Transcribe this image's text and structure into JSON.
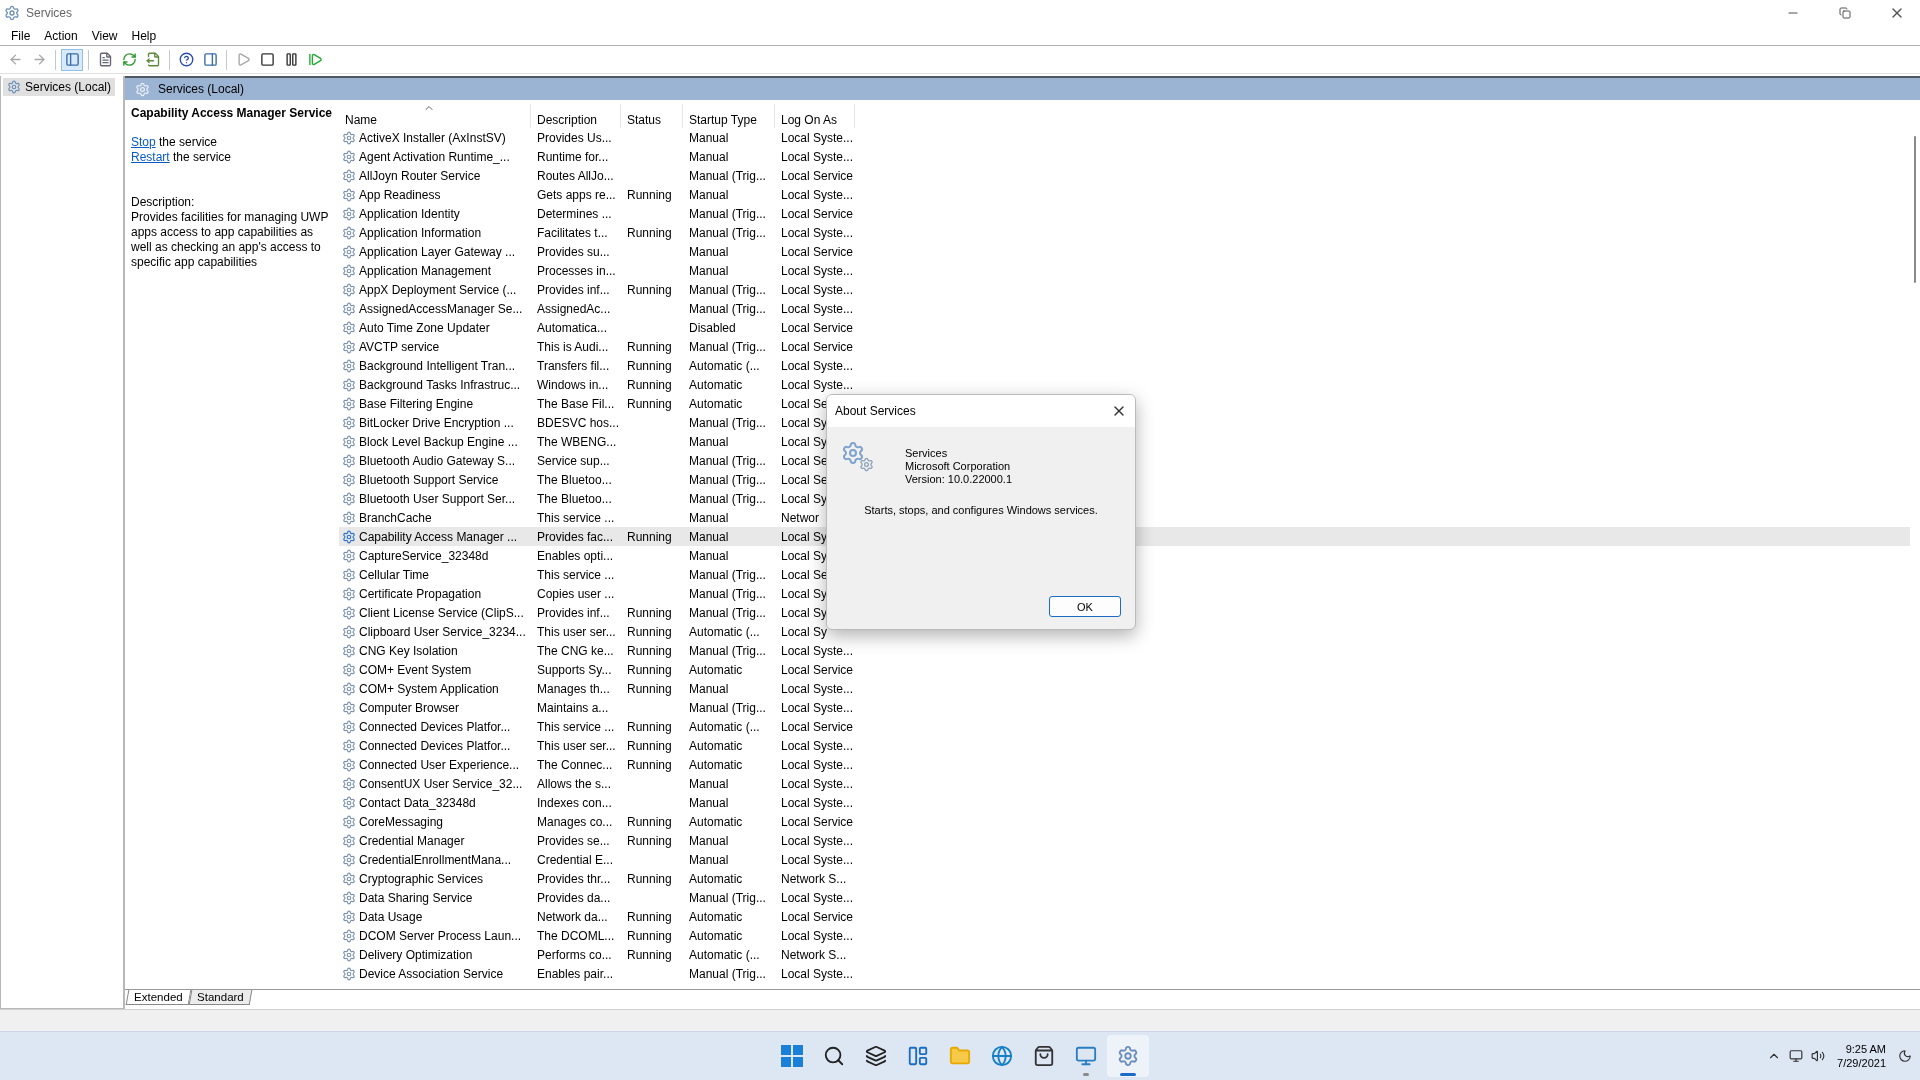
{
  "window": {
    "title": "Services"
  },
  "menu": [
    "File",
    "Action",
    "View",
    "Help"
  ],
  "toolbar": [
    [
      {
        "kind": "back",
        "disabled": true,
        "pressed": false
      },
      {
        "kind": "forward",
        "disabled": true,
        "pressed": false
      }
    ],
    [
      {
        "kind": "tree",
        "disabled": false,
        "pressed": true
      }
    ],
    [
      {
        "kind": "properties",
        "disabled": false,
        "pressed": false
      },
      {
        "kind": "refresh",
        "disabled": false,
        "pressed": false
      },
      {
        "kind": "export",
        "disabled": false,
        "pressed": false
      }
    ],
    [
      {
        "kind": "help",
        "disabled": false,
        "pressed": false
      },
      {
        "kind": "action_pane",
        "disabled": false,
        "pressed": false
      }
    ],
    [
      {
        "kind": "start",
        "disabled": true,
        "pressed": false
      },
      {
        "kind": "stop",
        "disabled": false,
        "pressed": false
      },
      {
        "kind": "pause",
        "disabled": false,
        "pressed": false
      },
      {
        "kind": "resume",
        "disabled": false,
        "pressed": false
      }
    ]
  ],
  "tree": [
    {
      "label": "Services (Local)",
      "selected": true
    }
  ],
  "panel": {
    "title": "Services (Local)"
  },
  "details": {
    "title": "Capability Access Manager Service",
    "actions": [
      {
        "link": "Stop",
        "text": " the service"
      },
      {
        "link": "Restart",
        "text": " the service"
      }
    ],
    "description_label": "Description:",
    "description": "Provides facilities for managing UWP apps access to app capabilities as well as checking an app's access to specific app capabilities"
  },
  "table": {
    "columns": [
      {
        "label": "Name",
        "sorted": true
      },
      {
        "label": "Description",
        "sorted": false
      },
      {
        "label": "Status",
        "sorted": false
      },
      {
        "label": "Startup Type",
        "sorted": false
      },
      {
        "label": "Log On As",
        "sorted": false
      }
    ],
    "rows": [
      {
        "name": "ActiveX Installer (AxInstSV)",
        "description": "Provides Us...",
        "startup_type": "Manual",
        "log_on_as": "Local Syste...",
        "selected": false
      },
      {
        "name": "Agent Activation Runtime_...",
        "description": "Runtime for...",
        "startup_type": "Manual",
        "log_on_as": "Local Syste...",
        "selected": false
      },
      {
        "name": "AllJoyn Router Service",
        "description": "Routes AllJo...",
        "startup_type": "Manual (Trig...",
        "log_on_as": "Local Service",
        "selected": false
      },
      {
        "name": "App Readiness",
        "description": "Gets apps re...",
        "status": "Running",
        "startup_type": "Manual",
        "log_on_as": "Local Syste...",
        "selected": false
      },
      {
        "name": "Application Identity",
        "description": "Determines ...",
        "startup_type": "Manual (Trig...",
        "log_on_as": "Local Service",
        "selected": false
      },
      {
        "name": "Application Information",
        "description": "Facilitates t...",
        "status": "Running",
        "startup_type": "Manual (Trig...",
        "log_on_as": "Local Syste...",
        "selected": false
      },
      {
        "name": "Application Layer Gateway ...",
        "description": "Provides su...",
        "startup_type": "Manual",
        "log_on_as": "Local Service",
        "selected": false
      },
      {
        "name": "Application Management",
        "description": "Processes in...",
        "startup_type": "Manual",
        "log_on_as": "Local Syste...",
        "selected": false
      },
      {
        "name": "AppX Deployment Service (...",
        "description": "Provides inf...",
        "status": "Running",
        "startup_type": "Manual (Trig...",
        "log_on_as": "Local Syste...",
        "selected": false
      },
      {
        "name": "AssignedAccessManager Se...",
        "description": "AssignedAc...",
        "startup_type": "Manual (Trig...",
        "log_on_as": "Local Syste...",
        "selected": false
      },
      {
        "name": "Auto Time Zone Updater",
        "description": "Automatica...",
        "startup_type": "Disabled",
        "log_on_as": "Local Service",
        "selected": false
      },
      {
        "name": "AVCTP service",
        "description": "This is Audi...",
        "status": "Running",
        "startup_type": "Manual (Trig...",
        "log_on_as": "Local Service",
        "selected": false
      },
      {
        "name": "Background Intelligent Tran...",
        "description": "Transfers fil...",
        "status": "Running",
        "startup_type": "Automatic (...",
        "log_on_as": "Local Syste...",
        "selected": false
      },
      {
        "name": "Background Tasks Infrastruc...",
        "description": "Windows in...",
        "status": "Running",
        "startup_type": "Automatic",
        "log_on_as": "Local Syste...",
        "selected": false
      },
      {
        "name": "Base Filtering Engine",
        "description": "The Base Fil...",
        "status": "Running",
        "startup_type": "Automatic",
        "log_on_as": "Local Se",
        "selected": false
      },
      {
        "name": "BitLocker Drive Encryption ...",
        "description": "BDESVC hos...",
        "startup_type": "Manual (Trig...",
        "log_on_as": "Local Sy",
        "selected": false
      },
      {
        "name": "Block Level Backup Engine ...",
        "description": "The WBENG...",
        "startup_type": "Manual",
        "log_on_as": "Local Sy",
        "selected": false
      },
      {
        "name": "Bluetooth Audio Gateway S...",
        "description": "Service sup...",
        "startup_type": "Manual (Trig...",
        "log_on_as": "Local Se",
        "selected": false
      },
      {
        "name": "Bluetooth Support Service",
        "description": "The Bluetoo...",
        "startup_type": "Manual (Trig...",
        "log_on_as": "Local Se",
        "selected": false
      },
      {
        "name": "Bluetooth User Support Ser...",
        "description": "The Bluetoo...",
        "startup_type": "Manual (Trig...",
        "log_on_as": "Local Sy",
        "selected": false
      },
      {
        "name": "BranchCache",
        "description": "This service ...",
        "startup_type": "Manual",
        "log_on_as": "Networ",
        "selected": false
      },
      {
        "name": "Capability Access Manager ...",
        "description": "Provides fac...",
        "status": "Running",
        "startup_type": "Manual",
        "log_on_as": "Local Sy",
        "selected": true
      },
      {
        "name": "CaptureService_32348d",
        "description": "Enables opti...",
        "startup_type": "Manual",
        "log_on_as": "Local Sy",
        "selected": false
      },
      {
        "name": "Cellular Time",
        "description": "This service ...",
        "startup_type": "Manual (Trig...",
        "log_on_as": "Local Se",
        "selected": false
      },
      {
        "name": "Certificate Propagation",
        "description": "Copies user ...",
        "startup_type": "Manual (Trig...",
        "log_on_as": "Local Sy",
        "selected": false
      },
      {
        "name": "Client License Service (ClipS...",
        "description": "Provides inf...",
        "status": "Running",
        "startup_type": "Manual (Trig...",
        "log_on_as": "Local Sy",
        "selected": false
      },
      {
        "name": "Clipboard User Service_3234...",
        "description": "This user ser...",
        "status": "Running",
        "startup_type": "Automatic (...",
        "log_on_as": "Local Sy",
        "selected": false
      },
      {
        "name": "CNG Key Isolation",
        "description": "The CNG ke...",
        "status": "Running",
        "startup_type": "Manual (Trig...",
        "log_on_as": "Local Syste...",
        "selected": false
      },
      {
        "name": "COM+ Event System",
        "description": "Supports Sy...",
        "status": "Running",
        "startup_type": "Automatic",
        "log_on_as": "Local Service",
        "selected": false
      },
      {
        "name": "COM+ System Application",
        "description": "Manages th...",
        "status": "Running",
        "startup_type": "Manual",
        "log_on_as": "Local Syste...",
        "selected": false
      },
      {
        "name": "Computer Browser",
        "description": "Maintains a...",
        "startup_type": "Manual (Trig...",
        "log_on_as": "Local Syste...",
        "selected": false
      },
      {
        "name": "Connected Devices Platfor...",
        "description": "This service ...",
        "status": "Running",
        "startup_type": "Automatic (...",
        "log_on_as": "Local Service",
        "selected": false
      },
      {
        "name": "Connected Devices Platfor...",
        "description": "This user ser...",
        "status": "Running",
        "startup_type": "Automatic",
        "log_on_as": "Local Syste...",
        "selected": false
      },
      {
        "name": "Connected User Experience...",
        "description": "The Connec...",
        "status": "Running",
        "startup_type": "Automatic",
        "log_on_as": "Local Syste...",
        "selected": false
      },
      {
        "name": "ConsentUX User Service_32...",
        "description": "Allows the s...",
        "startup_type": "Manual",
        "log_on_as": "Local Syste...",
        "selected": false
      },
      {
        "name": "Contact Data_32348d",
        "description": "Indexes con...",
        "startup_type": "Manual",
        "log_on_as": "Local Syste...",
        "selected": false
      },
      {
        "name": "CoreMessaging",
        "description": "Manages co...",
        "status": "Running",
        "startup_type": "Automatic",
        "log_on_as": "Local Service",
        "selected": false
      },
      {
        "name": "Credential Manager",
        "description": "Provides se...",
        "status": "Running",
        "startup_type": "Manual",
        "log_on_as": "Local Syste...",
        "selected": false
      },
      {
        "name": "CredentialEnrollmentMana...",
        "description": "Credential E...",
        "startup_type": "Manual",
        "log_on_as": "Local Syste...",
        "selected": false
      },
      {
        "name": "Cryptographic Services",
        "description": "Provides thr...",
        "status": "Running",
        "startup_type": "Automatic",
        "log_on_as": "Network S...",
        "selected": false
      },
      {
        "name": "Data Sharing Service",
        "description": "Provides da...",
        "startup_type": "Manual (Trig...",
        "log_on_as": "Local Syste...",
        "selected": false
      },
      {
        "name": "Data Usage",
        "description": "Network da...",
        "status": "Running",
        "startup_type": "Automatic",
        "log_on_as": "Local Service",
        "selected": false
      },
      {
        "name": "DCOM Server Process Laun...",
        "description": "The DCOML...",
        "status": "Running",
        "startup_type": "Automatic",
        "log_on_as": "Local Syste...",
        "selected": false
      },
      {
        "name": "Delivery Optimization",
        "description": "Performs co...",
        "status": "Running",
        "startup_type": "Automatic (...",
        "log_on_as": "Network S...",
        "selected": false
      },
      {
        "name": "Device Association Service",
        "description": "Enables pair...",
        "startup_type": "Manual (Trig...",
        "log_on_as": "Local Syste...",
        "selected": false
      }
    ]
  },
  "view_tabs": [
    {
      "label": "Extended",
      "selected": true
    },
    {
      "label": "Standard",
      "selected": false
    }
  ],
  "dialog": {
    "title": "About Services",
    "lines": [
      "Services",
      "Microsoft Corporation",
      "Version: 10.0.22000.1"
    ],
    "description": "Starts, stops, and configures Windows services.",
    "button": "OK"
  },
  "taskbar": {
    "apps": [
      {
        "kind": "start",
        "running": false,
        "active": false
      },
      {
        "kind": "search",
        "running": false,
        "active": false
      },
      {
        "kind": "task_view",
        "running": false,
        "active": false
      },
      {
        "kind": "widgets",
        "running": false,
        "active": false
      },
      {
        "kind": "files",
        "running": false,
        "active": false
      },
      {
        "kind": "browser",
        "running": false,
        "active": false
      },
      {
        "kind": "store",
        "running": false,
        "active": false
      },
      {
        "kind": "control_panel",
        "running": true,
        "active": false
      },
      {
        "kind": "services",
        "running": true,
        "active": true
      }
    ],
    "clock": {
      "time": "9:25 AM",
      "date": "7/29/2021"
    }
  }
}
